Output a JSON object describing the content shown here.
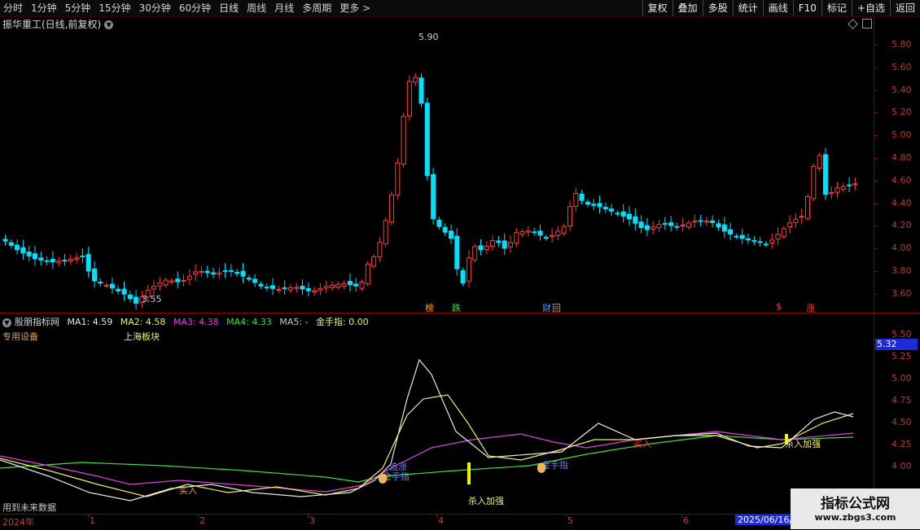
{
  "toolbar": {
    "periods": [
      "分时",
      "1分钟",
      "5分钟",
      "15分钟",
      "30分钟",
      "60分钟",
      "日线",
      "周线",
      "月线",
      "多周期",
      "更多 >"
    ],
    "actions": [
      "复权",
      "叠加",
      "多股",
      "统计",
      "画线",
      "F10",
      "标记",
      "+自选",
      "返回"
    ]
  },
  "stock": {
    "title": "振华重工(日线,前复权)",
    "high_label": "5.90",
    "low_label": "3.55"
  },
  "price_axis": [
    "5.80",
    "5.60",
    "5.40",
    "5.20",
    "5.00",
    "4.80",
    "4.60",
    "4.40",
    "4.20",
    "4.00",
    "3.80",
    "3.60"
  ],
  "event_tags": [
    {
      "text": "榜",
      "color": "#f0a030"
    },
    {
      "text": "跌",
      "color": "#40d040"
    },
    {
      "text": "财",
      "color": "#40a0ff"
    },
    {
      "text": "回",
      "color": "#ff8040"
    },
    {
      "text": "$",
      "color": "#ff3030"
    },
    {
      "text": "涨",
      "color": "#ff3030"
    }
  ],
  "indicator": {
    "name": "股朋指标网",
    "ma": [
      {
        "label": "MA1: 4.59",
        "color": "#e8e8e8"
      },
      {
        "label": "MA2: 4.58",
        "color": "#f0f060"
      },
      {
        "label": "MA3: 4.38",
        "color": "#e040e0"
      },
      {
        "label": "MA4: 4.33",
        "color": "#40e040"
      },
      {
        "label": "MA5: -",
        "color": "#c8c8c8"
      },
      {
        "label": "金手指: 0.00",
        "color": "#f0f060"
      }
    ],
    "industry": "专用设备",
    "sector": "上海板块",
    "axis": [
      "5.50",
      "5.25",
      "5.00",
      "4.75",
      "4.50",
      "4.25",
      "4.00"
    ],
    "current": "5.32",
    "bottom_note": "用到未来数据",
    "signals": {
      "buy": "买入",
      "zhang": "追涨",
      "jinshouzhi": "金手指",
      "kill": "杀入加强"
    }
  },
  "dates": {
    "year": "2024年",
    "months": [
      "1",
      "2",
      "3",
      "4",
      "5",
      "6"
    ],
    "cursor_date": "2025/06/16/"
  },
  "watermark": {
    "title": "指标公式网",
    "url": "www.zbgs3.com"
  },
  "colors": {
    "up": "#ff3c3c",
    "down": "#00e0ff",
    "axis": "#8b0000"
  }
}
